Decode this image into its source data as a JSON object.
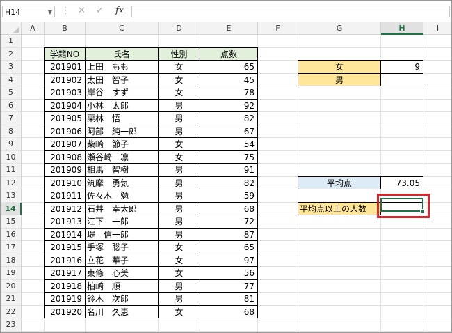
{
  "formula_bar": {
    "name_box": "H14",
    "cancel_icon": "cancel-icon",
    "enter_icon": "check-icon",
    "fx_label": "fx",
    "formula": ""
  },
  "columns": [
    "A",
    "B",
    "C",
    "D",
    "E",
    "F",
    "G",
    "H",
    "I"
  ],
  "active_column": "H",
  "rows": [
    "1",
    "2",
    "3",
    "4",
    "5",
    "6",
    "7",
    "8",
    "9",
    "10",
    "11",
    "12",
    "13",
    "14",
    "15",
    "16",
    "17",
    "18",
    "19",
    "20",
    "21",
    "22",
    "23",
    "24"
  ],
  "active_row": "14",
  "table": {
    "headers": [
      "学籍NO",
      "氏名",
      "性別",
      "点数"
    ],
    "records": [
      [
        "201901",
        "上田　もも",
        "女",
        "65"
      ],
      [
        "201902",
        "太田　智子",
        "女",
        "45"
      ],
      [
        "201903",
        "岸谷　すず",
        "女",
        "78"
      ],
      [
        "201904",
        "小林　太郎",
        "男",
        "92"
      ],
      [
        "201905",
        "栗林　悟",
        "男",
        "82"
      ],
      [
        "201906",
        "阿部　純一郎",
        "男",
        "67"
      ],
      [
        "201907",
        "柴崎　節子",
        "女",
        "54"
      ],
      [
        "201908",
        "瀬谷崎　凛",
        "女",
        "75"
      ],
      [
        "201909",
        "相馬　智樹",
        "男",
        "91"
      ],
      [
        "201910",
        "筑摩　勇気",
        "男",
        "82"
      ],
      [
        "201911",
        "佐々木　勉",
        "男",
        "59"
      ],
      [
        "201912",
        "石井　幸太郎",
        "男",
        "68"
      ],
      [
        "201913",
        "江下　一郎",
        "男",
        "72"
      ],
      [
        "201914",
        "堤　信一郎",
        "男",
        "87"
      ],
      [
        "201915",
        "手塚　聡子",
        "女",
        "65"
      ],
      [
        "201916",
        "立花　華子",
        "女",
        "97"
      ],
      [
        "201917",
        "東條　心美",
        "女",
        "56"
      ],
      [
        "201918",
        "柏崎　順",
        "男",
        "77"
      ],
      [
        "201919",
        "鈴木　次郎",
        "男",
        "81"
      ],
      [
        "201920",
        "名川　久恵",
        "女",
        "68"
      ]
    ]
  },
  "summary": {
    "female_label": "女",
    "female_count": "9",
    "male_label": "男",
    "male_count": "",
    "average_label": "平均点",
    "average_value": "73.05",
    "above_avg_label": "平均点以上の人数",
    "above_avg_value": ""
  },
  "colors": {
    "header_fill": "#e2efda",
    "label_fill_yellow": "#ffe699",
    "label_fill_blue": "#ddebf7",
    "selection": "#217346",
    "highlight_box": "#d9262b"
  }
}
